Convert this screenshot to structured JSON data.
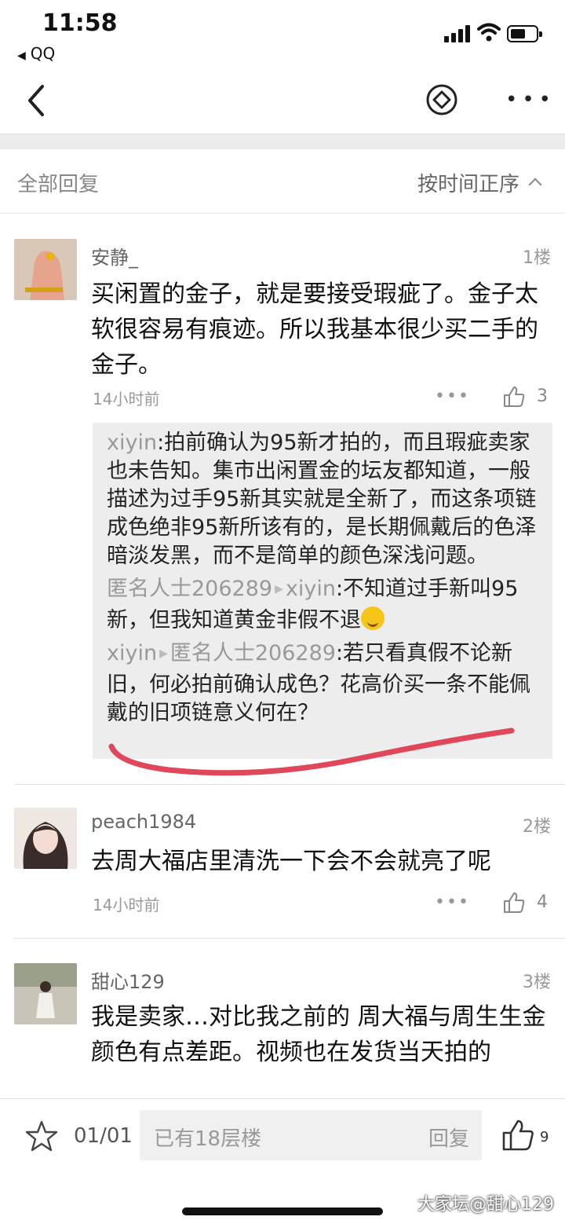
{
  "status": {
    "time": "11:58",
    "back_app": "QQ"
  },
  "filter": {
    "all_label": "全部回复",
    "sort_label": "按时间正序"
  },
  "posts": [
    {
      "username": "安静_",
      "floor": "1楼",
      "content": "买闲置的金子，就是要接受瑕疵了。金子太软很容易有痕迹。所以我基本很少买二手的金子。",
      "time": "14小时前",
      "likes": "3",
      "more": "•••",
      "replies": [
        {
          "from": "xiyin",
          "to": "",
          "text": "拍前确认为95新才拍的，而且瑕疵卖家也未告知。集市出闲置金的坛友都知道，一般描述为过手95新其实就是全新了，而这条项链成色绝非95新所该有的，是长期佩戴后的色泽暗淡发黑，而不是简单的颜色深浅问题。"
        },
        {
          "from": "匿名人士206289",
          "to": "xiyin",
          "text": "不知道过手新叫95新，但我知道黄金非假不退"
        },
        {
          "from": "xiyin",
          "to": "匿名人士206289",
          "text": "若只看真假不论新旧，何必拍前确认成色？花高价买一条不能佩戴的旧项链意义何在？"
        }
      ]
    },
    {
      "username": "peach1984",
      "floor": "2楼",
      "content": "去周大福店里清洗一下会不会就亮了呢",
      "time": "14小时前",
      "likes": "4",
      "more": "•••"
    },
    {
      "username": "甜心129",
      "floor": "3楼",
      "content": "我是卖家…对比我之前的 周大福与周生生金颜色有点差距。视频也在发货当天拍的"
    }
  ],
  "bottom": {
    "pager": "01/01",
    "placeholder": "已有18层楼",
    "reply_label": "回复",
    "likes": "9"
  },
  "watermark": "大家坛@甜心129",
  "colors": {
    "annotation_stroke": "#e0475a",
    "quote_bg": "#ededed"
  }
}
